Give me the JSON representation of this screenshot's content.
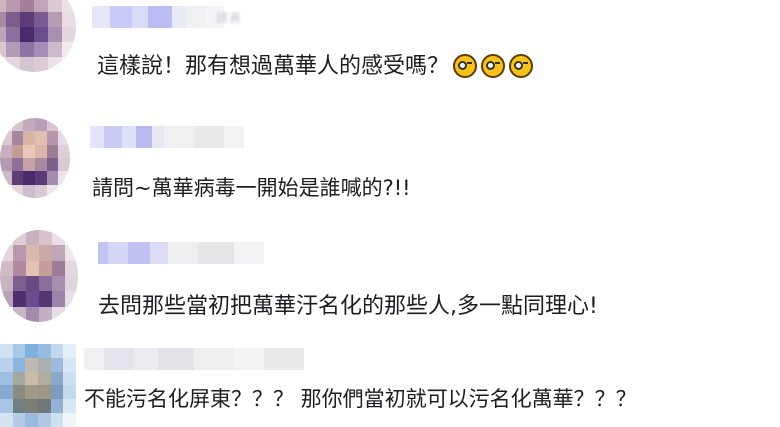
{
  "comments": [
    {
      "name": "請善",
      "text": "這樣說！那有想過萬華人的感受嗎？",
      "emojis": [
        "nerd-face-icon",
        "nerd-face-icon",
        "nerd-face-icon"
      ]
    },
    {
      "name": "",
      "text": "請問~萬華病毒一開始是誰喊的?!!"
    },
    {
      "name": "",
      "text": "去問那些當初把萬華汙名化的那些人,多一點同理心!"
    },
    {
      "name": "",
      "text": "不能污名化屏東？？？ 那你們當初就可以污名化萬華？？？"
    }
  ],
  "colors": {
    "text": "#1c1e21",
    "emoji": "#f7c21c",
    "blur_blue": "#c7c9f6",
    "blur_purple": "#6a4c8f"
  }
}
